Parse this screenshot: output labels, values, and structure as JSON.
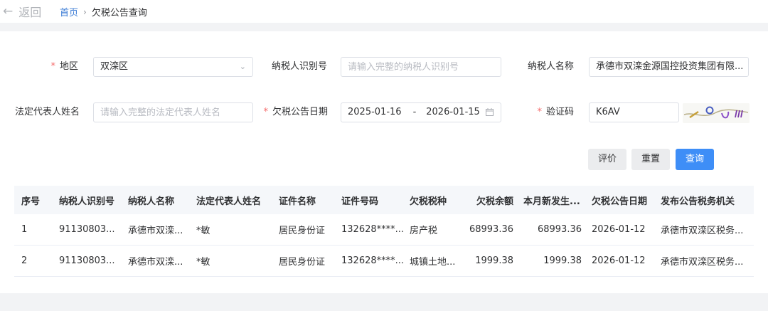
{
  "nav": {
    "back_label": "返回",
    "breadcrumb_home": "首页",
    "breadcrumb_current": "欠税公告查询"
  },
  "form": {
    "region": {
      "label": "地区",
      "value": "双滦区"
    },
    "taxpayer_id": {
      "label": "纳税人识别号",
      "placeholder": "请输入完整的纳税人识别号"
    },
    "taxpayer_name": {
      "label": "纳税人名称",
      "value": "承德市双滦金源国控投资集团有限..."
    },
    "legal_rep": {
      "label": "法定代表人姓名",
      "placeholder": "请输入完整的法定代表人姓名"
    },
    "notice_date": {
      "label": "欠税公告日期",
      "start": "2025-01-16",
      "separator": "-",
      "end": "2026-01-15"
    },
    "captcha": {
      "label": "验证码",
      "value": "K6AV"
    }
  },
  "buttons": {
    "evaluate": "评价",
    "reset": "重置",
    "query": "查询"
  },
  "table": {
    "headers": [
      "序号",
      "纳税人识别号",
      "纳税人名称",
      "法定代表人姓名",
      "证件名称",
      "证件号码",
      "欠税税种",
      "欠税余额",
      "本月新发生...",
      "欠税公告日期",
      "发布公告税务机关"
    ],
    "rows": [
      [
        "1",
        "91130803...",
        "承德市双滦...",
        "*敏",
        "居民身份证",
        "132628****...",
        "房产税",
        "68993.36",
        "68993.36",
        "2026-01-12",
        "承德市双滦区税务..."
      ],
      [
        "2",
        "91130803...",
        "承德市双滦...",
        "*敏",
        "居民身份证",
        "132628****...",
        "城镇土地...",
        "1999.38",
        "1999.38",
        "2026-01-12",
        "承德市双滦区税务..."
      ]
    ]
  },
  "colors": {
    "primary": "#3e8ef7",
    "link": "#3a7bd5",
    "required": "#f56c6c"
  }
}
